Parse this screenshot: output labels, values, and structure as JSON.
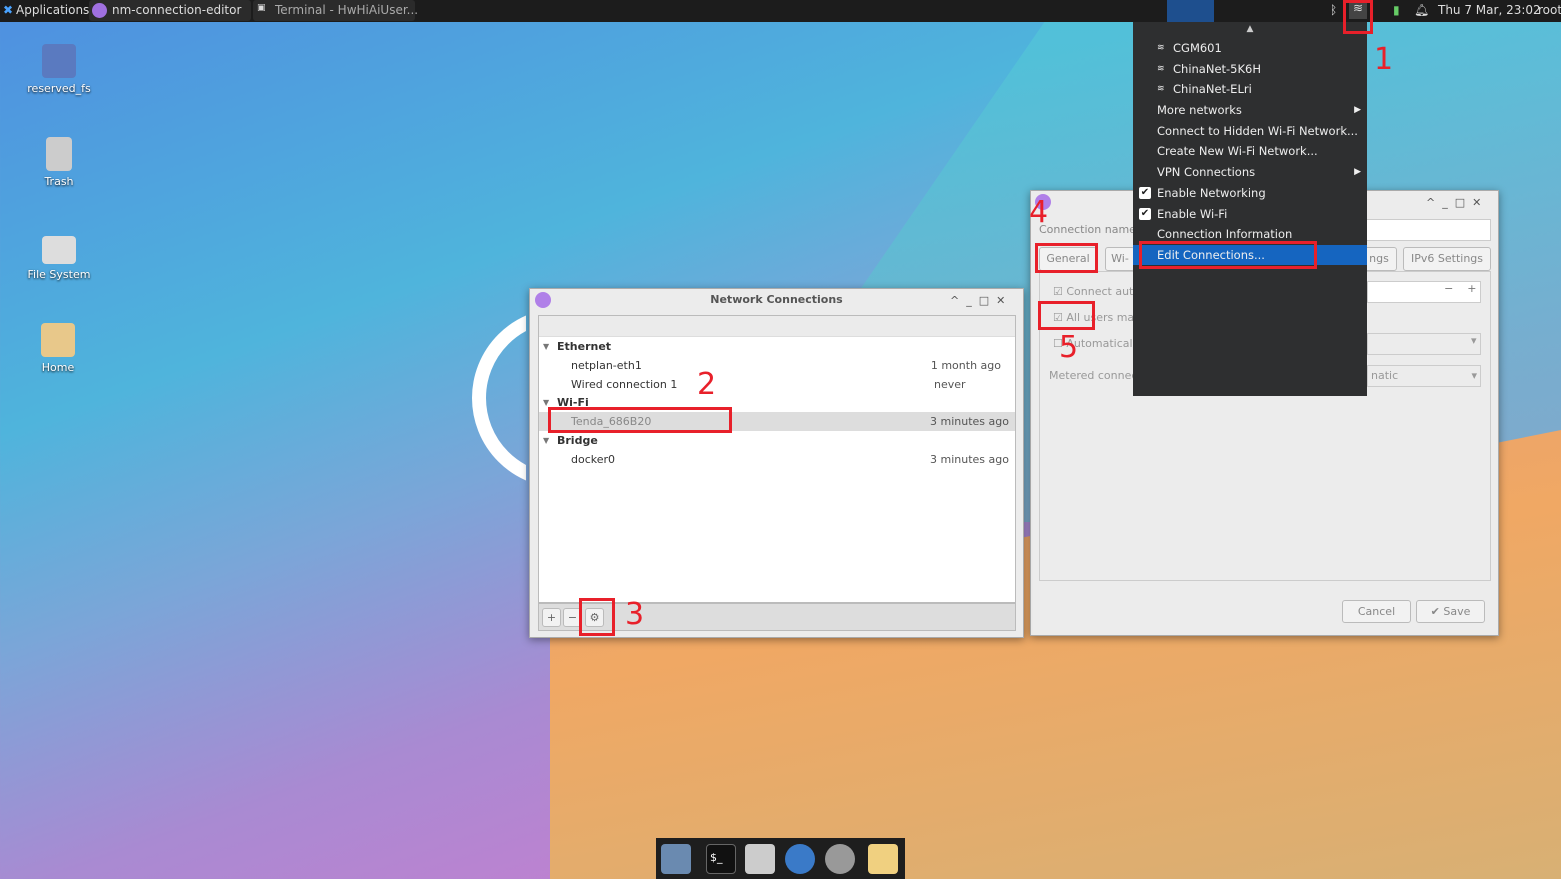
{
  "topbar": {
    "applications": "Applications",
    "tasks": [
      "nm-connection-editor",
      "Terminal - HwHiAiUser..."
    ],
    "clock": "Thu  7 Mar, 23:02",
    "user": "root",
    "task_badge": "2"
  },
  "desktop": [
    "reserved_fs",
    "Trash",
    "File System",
    "Home"
  ],
  "network_connections": {
    "title": "Network Connections",
    "groups": [
      {
        "name": "Ethernet",
        "items": [
          {
            "name": "netplan-eth1",
            "time": "1 month ago"
          },
          {
            "name": "Wired connection 1",
            "time": "never"
          }
        ]
      },
      {
        "name": "Wi-Fi",
        "items": [
          {
            "name": "Tenda_686B20",
            "time": "3 minutes ago"
          }
        ]
      },
      {
        "name": "Bridge",
        "items": [
          {
            "name": "docker0",
            "time": "3 minutes ago"
          }
        ]
      }
    ],
    "buttons": {
      "add": "+",
      "remove": "−",
      "settings": "⚙"
    }
  },
  "editor": {
    "connection_name_label": "Connection name",
    "tabs": [
      "General",
      "Wi-",
      "ngs",
      "IPv6 Settings"
    ],
    "connect_auto": "Connect aut",
    "all_users": "All users ma",
    "automatically": "Automatical",
    "metered": "Metered connec",
    "metered_value": "natic",
    "cancel": "Cancel",
    "save": "✔ Save"
  },
  "menu": {
    "networks": [
      "CGM601",
      "ChinaNet-5K6H",
      "ChinaNet-ELri"
    ],
    "more": "More networks",
    "hidden": "Connect to Hidden Wi-Fi Network...",
    "create": "Create New Wi-Fi Network...",
    "vpn": "VPN Connections",
    "enable_networking": "Enable Networking",
    "enable_wifi": "Enable Wi-Fi",
    "info": "Connection Information",
    "edit": "Edit Connections..."
  },
  "annotations": [
    "1",
    "2",
    "3",
    "4",
    "5"
  ],
  "colors": {
    "highlight": "#1565c0",
    "annotation": "#e8202a"
  }
}
